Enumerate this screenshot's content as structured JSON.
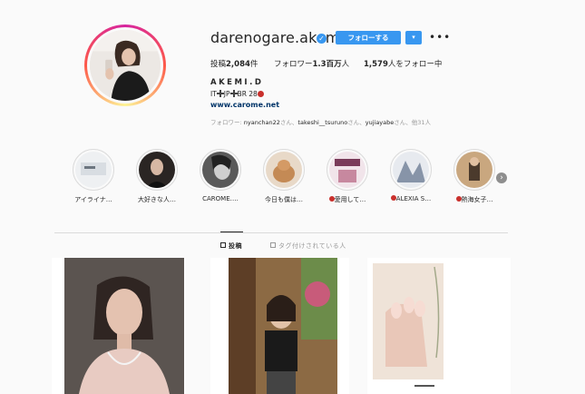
{
  "profile": {
    "username": "darenogare.akemi",
    "follow_label": "フォローする",
    "dropdown_icon": "chevron-down-icon",
    "more_icon": "ellipsis-icon",
    "more_label": "•••",
    "verified_icon": "✓"
  },
  "stats": {
    "posts_label": "投稿",
    "posts_count": "2,084",
    "posts_suffix": "件",
    "followers_label": "フォロワー",
    "followers_count": "1.3百万",
    "followers_suffix": "人",
    "following_count": "1,579",
    "following_label": "人をフォロー中"
  },
  "bio": {
    "display_name": "AKEMI.D",
    "line1_a": "IT",
    "line1_b": "JP",
    "line1_c": "BR 28",
    "website": "www.carome.net",
    "followed_by_prefix": "フォロワー: ",
    "followed_by_users": [
      "nyanchan22",
      "takeshi__tsuruno",
      "yujiayabe"
    ],
    "followed_by_sep": "さん、",
    "followed_by_suffix": "さん、他31人"
  },
  "highlights": [
    {
      "label": "アイライナ…"
    },
    {
      "label": "大好きな人…"
    },
    {
      "label": "CAROME…."
    },
    {
      "label": "今日も僕は…"
    },
    {
      "label": "愛用して…",
      "dot": true
    },
    {
      "label": "ALEXIA S…",
      "dot": true
    },
    {
      "label": "熱海女子…",
      "dot": true
    }
  ],
  "highlights_next_icon": "chevron-right-icon",
  "tabs": {
    "posts": "投稿",
    "tagged": "タグ付けされている人"
  },
  "colors": {
    "accent": "#3897f0",
    "link": "#003569",
    "background": "#fafafa"
  }
}
